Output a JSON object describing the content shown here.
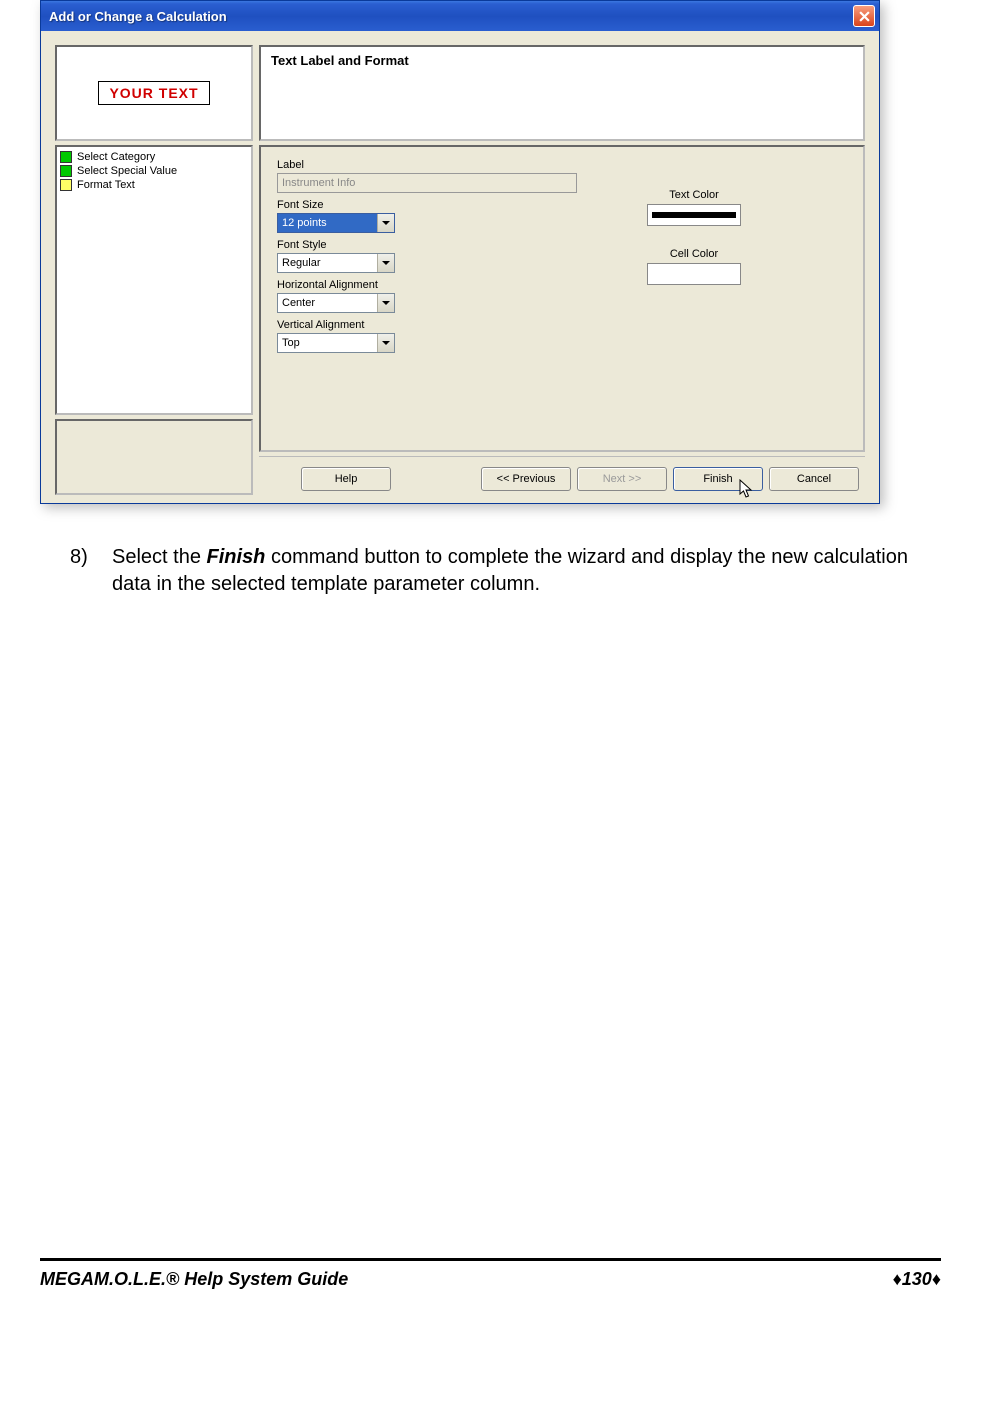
{
  "dialog": {
    "title": "Add or Change a Calculation",
    "preview": "YOUR TEXT",
    "steps": [
      {
        "label": "Select Category",
        "color": "green"
      },
      {
        "label": "Select Special Value",
        "color": "green"
      },
      {
        "label": "Format Text",
        "color": "yellow"
      }
    ],
    "header": "Text Label and Format",
    "fields": {
      "label_caption": "Label",
      "label_value": "Instrument Info",
      "fontsize_caption": "Font Size",
      "fontsize_value": "12 points",
      "fontstyle_caption": "Font Style",
      "fontstyle_value": "Regular",
      "halign_caption": "Horizontal Alignment",
      "halign_value": "Center",
      "valign_caption": "Vertical Alignment",
      "valign_value": "Top",
      "textcolor_caption": "Text Color",
      "cellcolor_caption": "Cell Color"
    },
    "buttons": {
      "help": "Help",
      "previous": "<< Previous",
      "next": "Next >>",
      "finish": "Finish",
      "cancel": "Cancel"
    }
  },
  "instruction": {
    "number": "8)",
    "prefix": "Select the ",
    "bold": "Finish",
    "suffix": " command button to complete the wizard and display the new calculation data in the selected template parameter column."
  },
  "footer": {
    "title_bold": "MEGA",
    "title_rest": "M.O.L.E.® Help System Guide",
    "page": "130"
  }
}
